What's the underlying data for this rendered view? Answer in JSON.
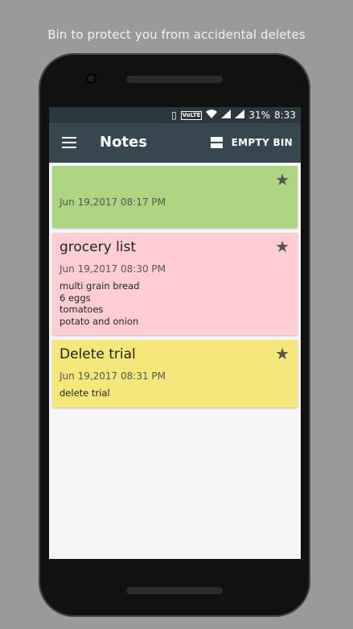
{
  "caption": "Bin to protect you from accidental deletes",
  "status": {
    "volte": "VoLTE",
    "battery": "31%",
    "time": "8:33"
  },
  "toolbar": {
    "title": "Notes",
    "empty_bin_label": "EMPTY BIN"
  },
  "notes": [
    {
      "title": "",
      "date": "Jun 19,2017  08:17 PM",
      "body": "",
      "color": "#aed581",
      "starred": true
    },
    {
      "title": "grocery list",
      "date": "Jun 19,2017  08:30 PM",
      "body": "multi grain bread\n6 eggs\ntomatoes\npotato and onion",
      "color": "#ffcdd2",
      "starred": true
    },
    {
      "title": "Delete trial",
      "date": "Jun 19,2017  08:31 PM",
      "body": "delete trial",
      "color": "#f5e77a",
      "starred": true
    }
  ],
  "icons": {
    "menu": "hamburger-icon",
    "layout": "layout-toggle-icon",
    "star": "star-icon"
  }
}
